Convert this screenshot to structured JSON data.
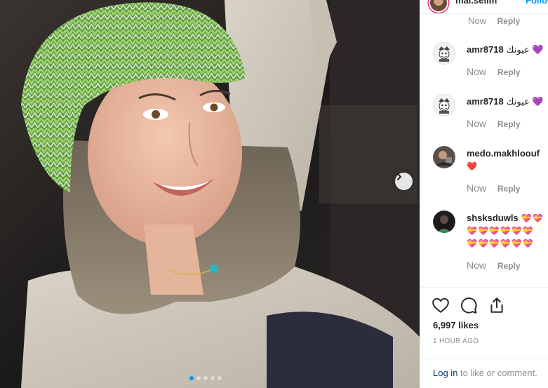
{
  "post": {
    "image_alt": "Woman in a green knit beanie and beige jacket smiling",
    "carousel_dots": 5,
    "carousel_active": 0
  },
  "header": {
    "username": "mai.selim",
    "follow_label": "Follow"
  },
  "top_comment_meta": {
    "time": "Now",
    "reply": "Reply"
  },
  "comments": [
    {
      "username": "amr8718",
      "text": "عيونك 💜",
      "time": "Now",
      "reply": "Reply"
    },
    {
      "username": "amr8718",
      "text": "عيونك 💜",
      "time": "Now",
      "reply": "Reply"
    },
    {
      "username": "medo.makhloouf",
      "text": "❤️",
      "time": "Now",
      "reply": "Reply"
    },
    {
      "username": "shsksduwls",
      "line1": "💝💝",
      "line2": "💝💝💝💝💝💝",
      "line3": "💝💝💝💝💝💝",
      "time": "Now",
      "reply": "Reply"
    }
  ],
  "actions": {
    "like_icon": "heart-icon",
    "comment_icon": "comment-bubble-icon",
    "share_icon": "share-icon",
    "likes": "6,997 likes",
    "timestamp": "1 HOUR AGO"
  },
  "login": {
    "link": "Log in",
    "rest": " to like or comment."
  },
  "colors": {
    "link_blue": "#0095f6",
    "dark_link": "#00376b",
    "meta_gray": "#8e8e8e",
    "heart_red": "#e0245e"
  }
}
